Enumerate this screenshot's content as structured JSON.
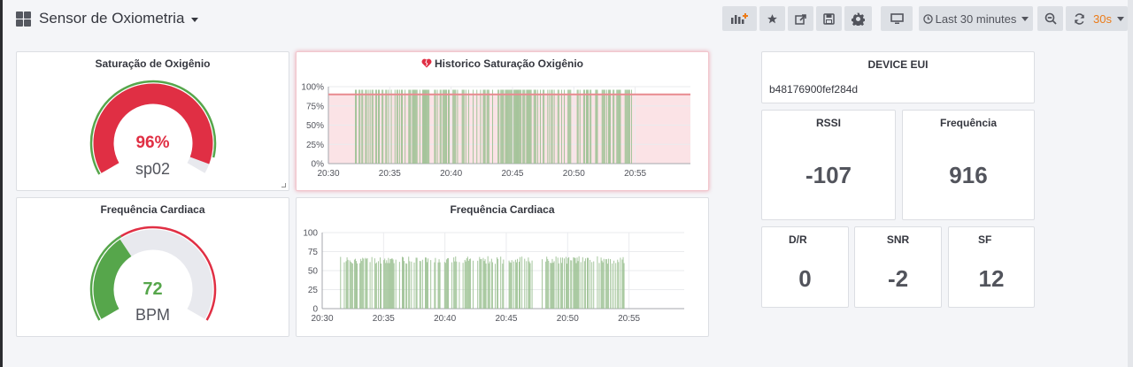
{
  "header": {
    "title": "Sensor de Oxiometria",
    "time_range": "Last 30 minutes",
    "refresh_interval": "30s"
  },
  "toolbar_icons": [
    "add-panel-icon",
    "star-icon",
    "share-icon",
    "save-icon",
    "gear-icon",
    "tv-icon",
    "clock-icon",
    "zoom-out-icon",
    "refresh-icon"
  ],
  "colors": {
    "red": "#e02f44",
    "green": "#56a64b",
    "accent_orange": "#eb7b18",
    "threshold_fill": "#fbe3e6",
    "gauge_track": "#e8e9ee"
  },
  "panels": {
    "spo2_gauge": {
      "title": "Saturação de Oxigênio",
      "value": "96%",
      "unit_label": "sp02",
      "fraction": 0.96
    },
    "spo2_history": {
      "title": "Historico Saturação Oxigênio",
      "heart_icon": "heart-broken-icon"
    },
    "device": {
      "title": "DEVICE EUI",
      "value": "b48176900fef284d"
    },
    "rssi": {
      "title": "RSSI",
      "value": "-107"
    },
    "frequency": {
      "title": "Frequência",
      "value": "916"
    },
    "hr_gauge": {
      "title": "Frequência Cardiaca",
      "value": "72",
      "unit_label": "BPM",
      "fraction": 0.36
    },
    "hr_history": {
      "title": "Frequência Cardiaca"
    },
    "dr": {
      "title": "D/R",
      "value": "0"
    },
    "snr": {
      "title": "SNR",
      "value": "-2"
    },
    "sf": {
      "title": "SF",
      "value": "12"
    }
  },
  "chart_data": [
    {
      "type": "bar",
      "title": "Historico Saturação Oxigênio",
      "x_ticks": [
        "20:30",
        "20:35",
        "20:40",
        "20:45",
        "20:50",
        "20:55"
      ],
      "y_ticks": [
        "0%",
        "25%",
        "50%",
        "75%",
        "100%"
      ],
      "ylim": [
        0,
        100
      ],
      "threshold": 90,
      "x_range_minutes": [
        0,
        29.5
      ],
      "x_value_note_minutes_after_2030": [
        2.2,
        25.2
      ],
      "value": 96,
      "grid": true
    },
    {
      "type": "bar",
      "title": "Frequência Cardiaca",
      "x_ticks": [
        "20:30",
        "20:35",
        "20:40",
        "20:45",
        "20:50",
        "20:55"
      ],
      "y_ticks": [
        "0",
        "25",
        "50",
        "75",
        "100"
      ],
      "ylim": [
        0,
        100
      ],
      "x_range_minutes": [
        0,
        29.5
      ],
      "value": 65,
      "grid": true
    }
  ]
}
